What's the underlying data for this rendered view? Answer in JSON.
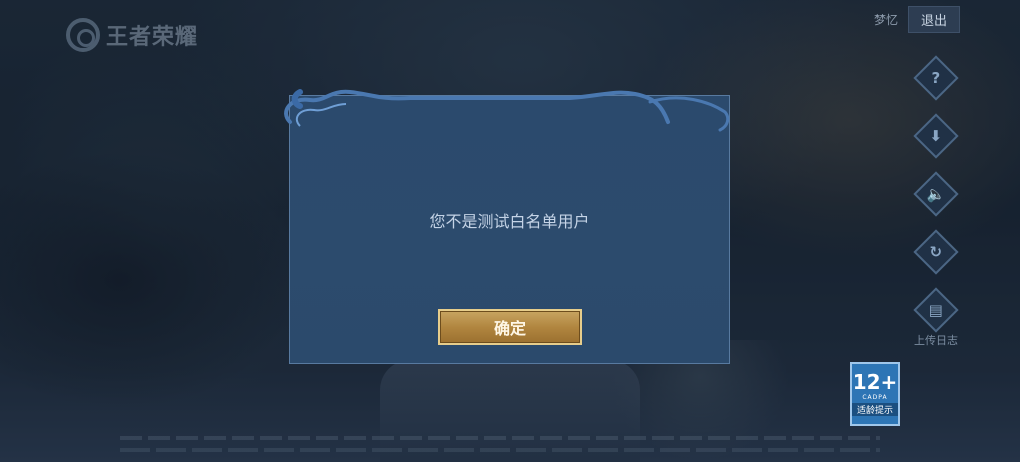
{
  "logo": {
    "text": "王者荣耀"
  },
  "top_right": {
    "dream_label": "梦忆",
    "exit_label": "退出"
  },
  "side_menu": [
    {
      "icon": "help-icon",
      "glyph": "?",
      "label": ""
    },
    {
      "icon": "download-icon",
      "glyph": "⬇",
      "label": ""
    },
    {
      "icon": "speaker-icon",
      "glyph": "🔈",
      "label": ""
    },
    {
      "icon": "repair-icon",
      "glyph": "↻",
      "label": ""
    },
    {
      "icon": "clipboard-icon",
      "glyph": "▤",
      "label": "上传日志"
    }
  ],
  "age_badge": {
    "rating": "12+",
    "org": "CADPA",
    "tip": "适龄提示"
  },
  "dialog": {
    "message": "您不是测试白名单用户",
    "confirm_label": "确定"
  },
  "colors": {
    "dialog_bg": "#2b4a6d",
    "button_gold": "#b18640",
    "border": "#587aa0"
  }
}
